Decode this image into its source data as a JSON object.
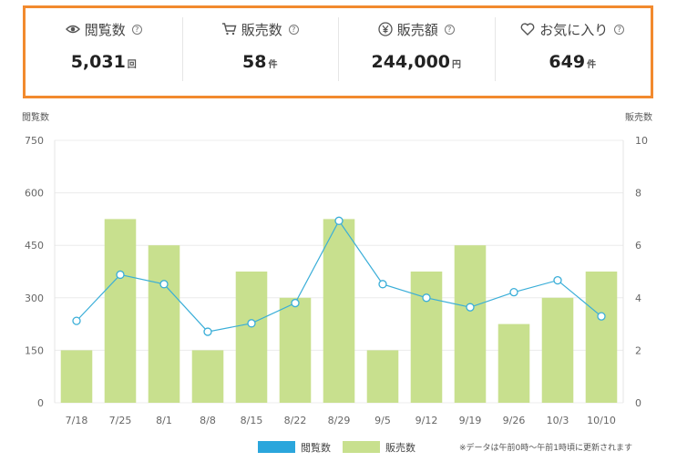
{
  "stats": [
    {
      "icon": "eye-icon",
      "label": "閲覧数",
      "value": "5,031",
      "unit": "回"
    },
    {
      "icon": "cart-icon",
      "label": "販売数",
      "value": "58",
      "unit": "件"
    },
    {
      "icon": "yen-icon",
      "label": "販売額",
      "value": "244,000",
      "unit": "円"
    },
    {
      "icon": "heart-icon",
      "label": "お気に入り",
      "value": "649",
      "unit": "件"
    }
  ],
  "help_glyph": "?",
  "chart_data": {
    "type": "bar",
    "categories": [
      "7/18",
      "7/25",
      "8/1",
      "8/8",
      "8/15",
      "8/22",
      "8/29",
      "9/5",
      "9/12",
      "9/19",
      "9/26",
      "10/3",
      "10/10"
    ],
    "series": [
      {
        "name": "閲覧数",
        "type": "line",
        "axis": "left",
        "color": "#3aaed8",
        "values": [
          234,
          366,
          339,
          203,
          227,
          285,
          520,
          339,
          300,
          273,
          316,
          350,
          247
        ]
      },
      {
        "name": "販売数",
        "type": "bar",
        "axis": "right",
        "color": "#c8e08e",
        "values": [
          2,
          7,
          6,
          2,
          5,
          4,
          7,
          2,
          5,
          6,
          3,
          4,
          5
        ]
      }
    ],
    "ylabel_left": "閲覧数",
    "ylabel_right": "販売数",
    "ylim_left": [
      0,
      750
    ],
    "ylim_right": [
      0,
      10
    ],
    "yticks_left": [
      0,
      150,
      300,
      450,
      600,
      750
    ],
    "yticks_right": [
      0,
      2,
      4,
      6,
      8,
      10
    ],
    "legend_position": "bottom",
    "legend_colors": {
      "閲覧数": "#2ba6dc",
      "販売数": "#c8e08e"
    },
    "grid": true,
    "note": "※データは午前0時～午前1時頃に更新されます"
  }
}
